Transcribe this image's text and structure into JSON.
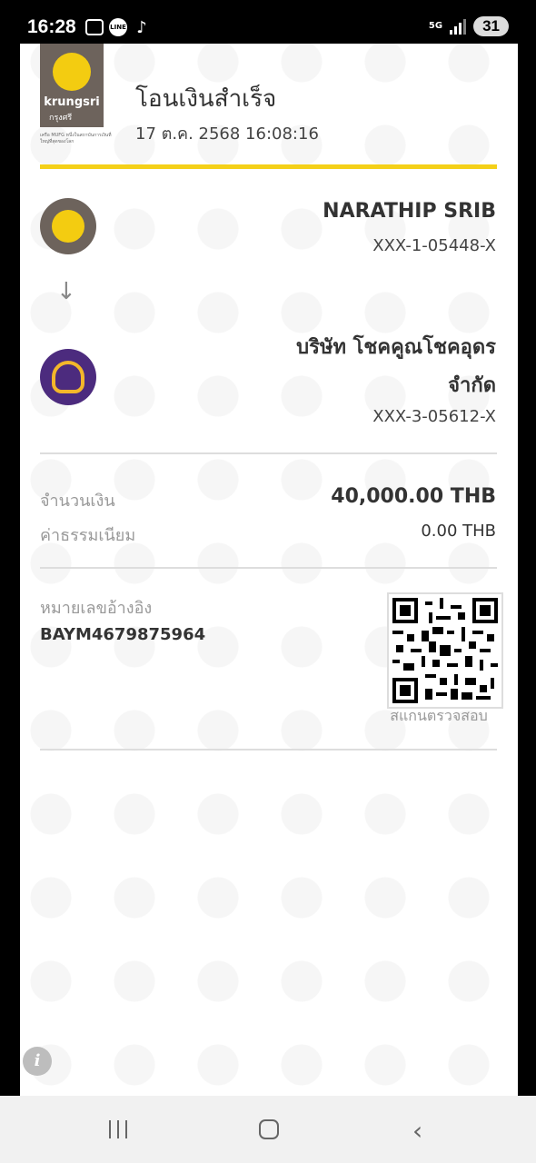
{
  "status_bar": {
    "time": "16:28",
    "network": "5G",
    "battery": "31",
    "notification_icons": [
      "screenshot-icon",
      "line-icon",
      "tiktok-icon"
    ]
  },
  "header": {
    "bank_brand": "krungsri",
    "bank_brand_th": "กรุงศรี",
    "mufg_note": "เครือ MUFG หนึ่งในสถาบันการเงินที่ใหญ่ที่สุดของโลก",
    "title": "โอนเงินสำเร็จ",
    "datetime": "17 ต.ค. 2568 16:08:16",
    "accent_color": "#f4d018"
  },
  "sender": {
    "name": "NARATHIP SRIB",
    "account": "XXX-1-05448-X",
    "icon": "krungsri-logo-icon"
  },
  "recipient": {
    "name_line1": "บริษัท โชคคูณโชคอุดร",
    "name_line2": "จำกัด",
    "account": "XXX-3-05612-X",
    "icon": "scb-logo-icon"
  },
  "amount": {
    "label": "จำนวนเงิน",
    "value": "40,000.00 THB"
  },
  "fee": {
    "label": "ค่าธรรมเนียม",
    "value": "0.00 THB"
  },
  "reference": {
    "label": "หมายเลขอ้างอิง",
    "value": "BAYM4679875964"
  },
  "qr": {
    "caption": "สแกนตรวจสอบ"
  },
  "info_icon": "i"
}
